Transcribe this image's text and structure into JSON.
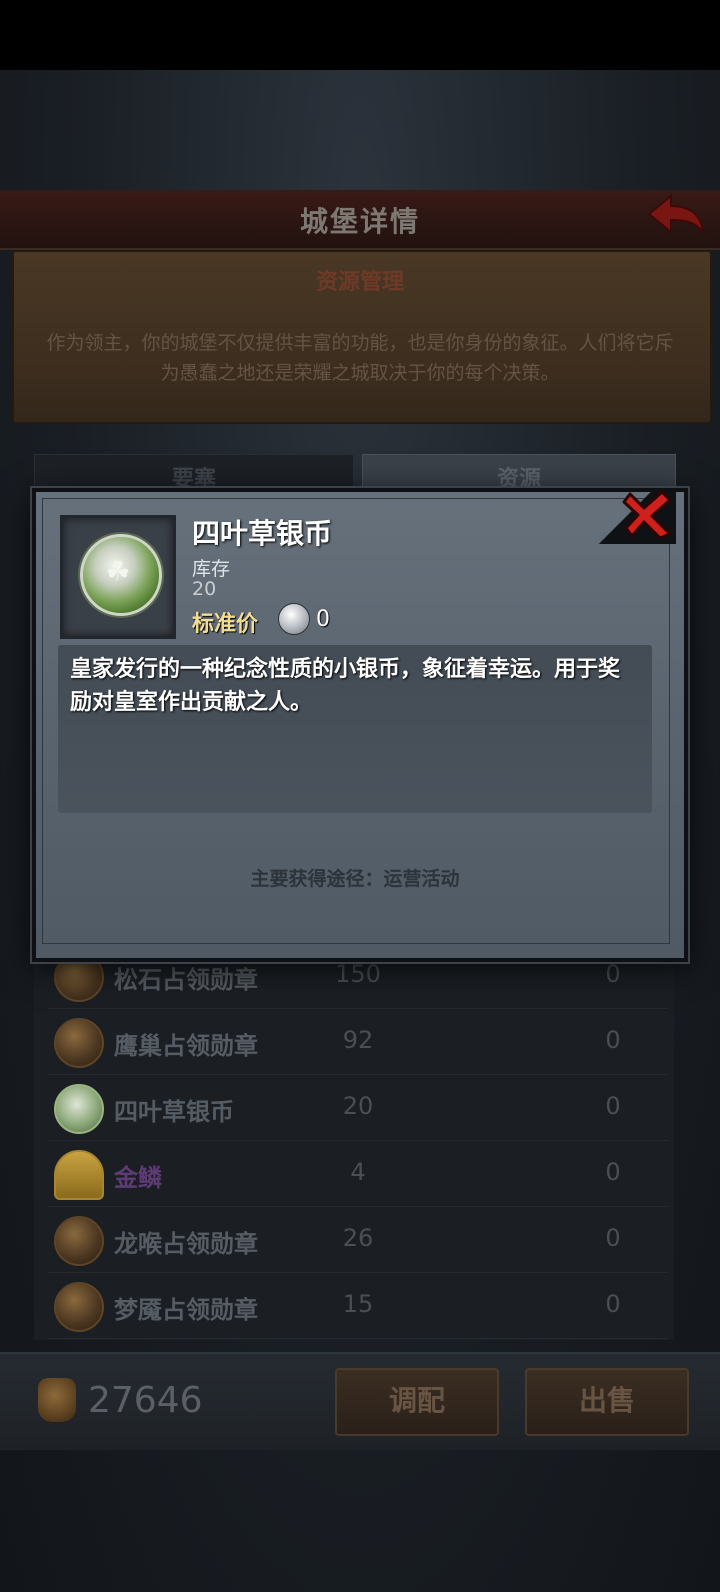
{
  "screen": {
    "title": "城堡详情",
    "back_icon": "red-arrow-back"
  },
  "resource_panel": {
    "title": "资源管理",
    "description": "作为领主，你的城堡不仅提供丰富的功能，也是你身份的象征。人们将它斥为愚蠢之地还是荣耀之城取决于你的每个决策。"
  },
  "tabs": [
    {
      "label": "要塞"
    },
    {
      "label": "资源"
    }
  ],
  "resource_list": [
    {
      "name": "松石占领勋章",
      "qty": "150",
      "sell": "0",
      "icon": "medal"
    },
    {
      "name": "鹰巢占领勋章",
      "qty": "92",
      "sell": "0",
      "icon": "medal"
    },
    {
      "name": "四叶草银币",
      "qty": "20",
      "sell": "0",
      "icon": "clover-coin"
    },
    {
      "name": "金鳞",
      "qty": "4",
      "sell": "0",
      "icon": "golden-scale"
    },
    {
      "name": "龙喉占领勋章",
      "qty": "26",
      "sell": "0",
      "icon": "medal"
    },
    {
      "name": "梦魇占领勋章",
      "qty": "15",
      "sell": "0",
      "icon": "medal"
    }
  ],
  "bottom_bar": {
    "gold_amount": "27646",
    "adjust_label": "调配",
    "sell_label": "出售"
  },
  "item_modal": {
    "name": "四叶草银币",
    "stock_label": "库存",
    "stock_value": "20",
    "price_label": "标准价",
    "price_value": "0",
    "description": "皇家发行的一种纪念性质的小银币，象征着幸运。用于奖励对皇室作出贡献之人。",
    "source": "主要获得途径：运营活动",
    "close_icon": "red-x"
  },
  "colors": {
    "title_bar": "#2a1512",
    "modal_bg": "#5b6570",
    "price_label": "#f0dc92",
    "close_red": "#d0201c",
    "purple_name": "#5e3b74"
  }
}
